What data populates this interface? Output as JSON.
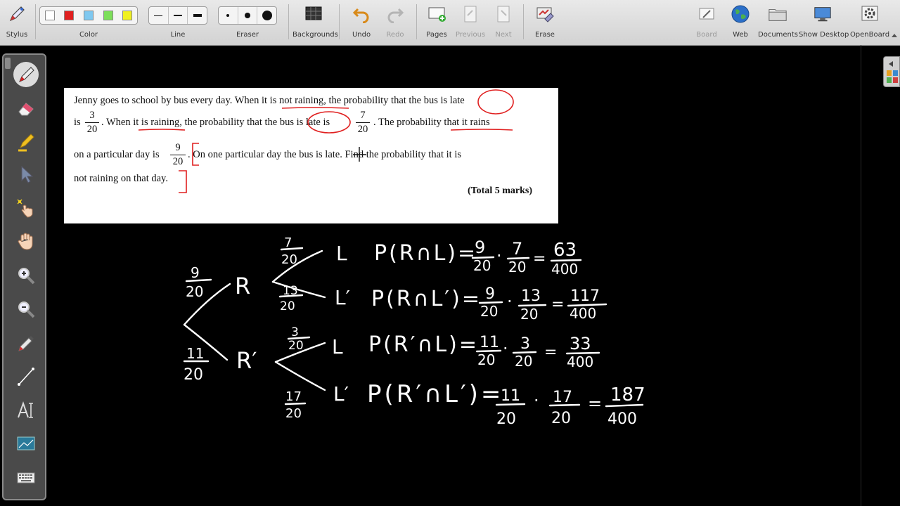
{
  "toolbar": {
    "stylus": "Stylus",
    "color": "Color",
    "line": "Line",
    "eraser": "Eraser",
    "backgrounds": "Backgrounds",
    "undo": "Undo",
    "redo": "Redo",
    "pages": "Pages",
    "previous": "Previous",
    "next": "Next",
    "erase": "Erase",
    "board": "Board",
    "web": "Web",
    "documents": "Documents",
    "show_desktop": "Show Desktop",
    "openboard": "OpenBoard",
    "colors": [
      "#ffffff",
      "#e02020",
      "#7fc8f0",
      "#7ddf5a",
      "#f0f020"
    ]
  },
  "dock": {
    "tools": [
      "pen-icon",
      "eraser-icon",
      "highlighter-icon",
      "pointer-icon",
      "laser-pointer-icon",
      "hand-icon",
      "zoom-in-icon",
      "zoom-out-icon",
      "color-picker-icon",
      "line-icon",
      "text-icon",
      "capture-icon",
      "keyboard-icon"
    ]
  },
  "question": {
    "l1a": "Jenny goes to school by bus every day. When it is not raining, the probability that the bus is late",
    "l2a": "is",
    "l2b": ". When it is raining, the probability that the bus is late is",
    "l2c": ". The probability that it rains",
    "l3a": "on a particular day is",
    "l3b": ". On one particular day the bus is late. Find the probability that it is",
    "l4": "not raining on that day.",
    "marks": "(Total 5 marks)",
    "f1_num": "3",
    "f1_den": "20",
    "f2_num": "7",
    "f2_den": "20",
    "f3_num": "9",
    "f3_den": "20"
  },
  "handwriting": {
    "b1_num": "9",
    "b1_den": "20",
    "b2_num": "11",
    "b2_den": "20",
    "r": "R",
    "r_prime": "R′",
    "c1_num": "7",
    "c1_den": "20",
    "c2_num": "13",
    "c2_den": "20",
    "c3_num": "3",
    "c3_den": "20",
    "c4_num": "17",
    "c4_den": "20",
    "l": "L",
    "l_prime": "L′",
    "eq1": "P(R∩L)=",
    "eq2": "P(R∩L′)=",
    "eq3": "P(R′∩L)=",
    "eq4": "P(R′∩L′)=",
    "eq1_a_num": "9",
    "eq1_a_den": "20",
    "eq1_b_num": "7",
    "eq1_b_den": "20",
    "eq1_r_num": "63",
    "eq1_r_den": "400",
    "eq2_a_num": "9",
    "eq2_a_den": "20",
    "eq2_b_num": "13",
    "eq2_b_den": "20",
    "eq2_r_num": "117",
    "eq2_r_den": "400",
    "eq3_a_num": "11",
    "eq3_a_den": "20",
    "eq3_b_num": "3",
    "eq3_b_den": "20",
    "eq3_r_num": "33",
    "eq3_r_den": "400",
    "eq4_a_num": "11",
    "eq4_a_den": "20",
    "eq4_b_num": "17",
    "eq4_b_den": "20",
    "eq4_r_num": "187",
    "eq4_r_den": "400",
    "dot": "·",
    "eq": "="
  }
}
